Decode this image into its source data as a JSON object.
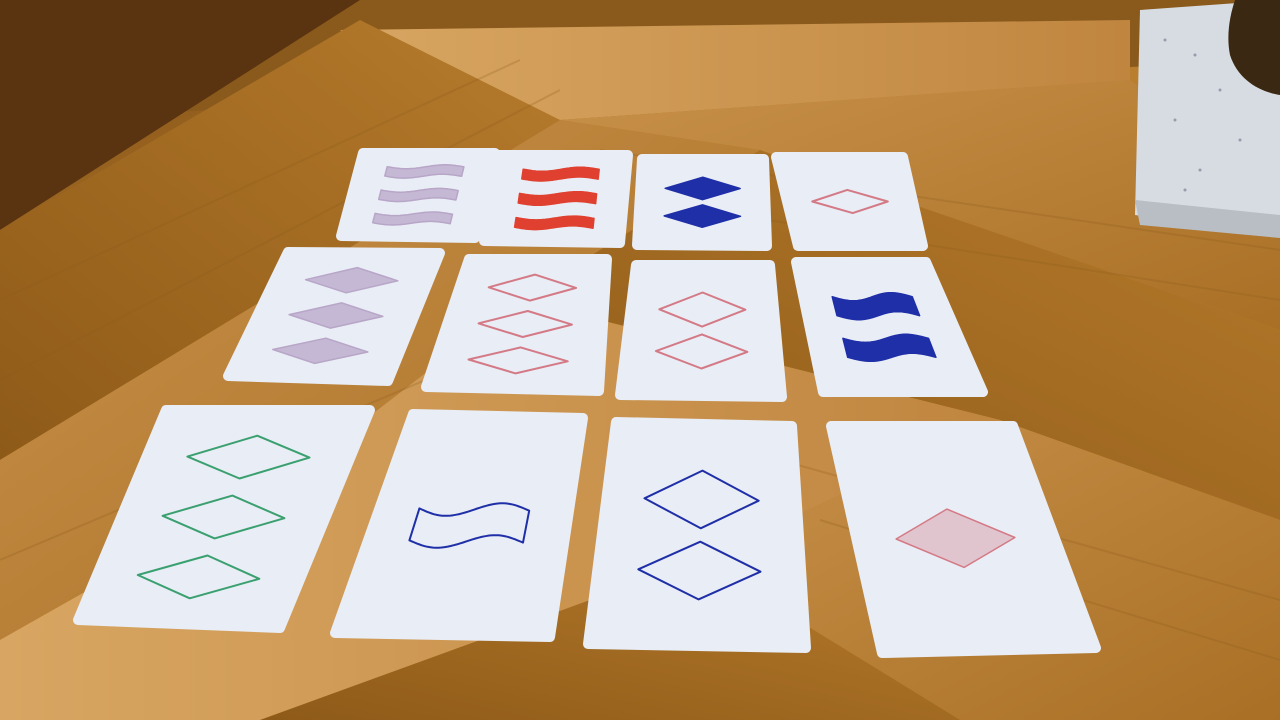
{
  "game": "Set",
  "colors": {
    "red": "#e0402f",
    "blue": "#1f2fa8",
    "green": "#3aa070",
    "pink": "#d47a86",
    "lavender": "#b8a6c8",
    "card": "#e9edf5"
  },
  "cards": [
    {
      "id": "r1c1",
      "row": 1,
      "col": 1,
      "count": 3,
      "shape": "squiggle",
      "color": "lavender",
      "fill": "solid-light"
    },
    {
      "id": "r1c2",
      "row": 1,
      "col": 2,
      "count": 3,
      "shape": "squiggle",
      "color": "red",
      "fill": "solid"
    },
    {
      "id": "r1c3",
      "row": 1,
      "col": 3,
      "count": 2,
      "shape": "diamond",
      "color": "blue",
      "fill": "solid"
    },
    {
      "id": "r1c4",
      "row": 1,
      "col": 4,
      "count": 1,
      "shape": "diamond",
      "color": "pink",
      "fill": "outline"
    },
    {
      "id": "r2c1",
      "row": 2,
      "col": 1,
      "count": 3,
      "shape": "diamond",
      "color": "lavender",
      "fill": "solid-light"
    },
    {
      "id": "r2c2",
      "row": 2,
      "col": 2,
      "count": 3,
      "shape": "diamond",
      "color": "pink",
      "fill": "outline"
    },
    {
      "id": "r2c3",
      "row": 2,
      "col": 3,
      "count": 2,
      "shape": "diamond",
      "color": "pink",
      "fill": "outline"
    },
    {
      "id": "r2c4",
      "row": 2,
      "col": 4,
      "count": 2,
      "shape": "squiggle",
      "color": "blue",
      "fill": "solid"
    },
    {
      "id": "r3c1",
      "row": 3,
      "col": 1,
      "count": 3,
      "shape": "diamond",
      "color": "green",
      "fill": "outline"
    },
    {
      "id": "r3c2",
      "row": 3,
      "col": 2,
      "count": 1,
      "shape": "squiggle",
      "color": "blue",
      "fill": "outline"
    },
    {
      "id": "r3c3",
      "row": 3,
      "col": 3,
      "count": 2,
      "shape": "diamond",
      "color": "blue",
      "fill": "outline"
    },
    {
      "id": "r3c4",
      "row": 3,
      "col": 4,
      "count": 1,
      "shape": "diamond",
      "color": "pink",
      "fill": "shaded"
    }
  ]
}
